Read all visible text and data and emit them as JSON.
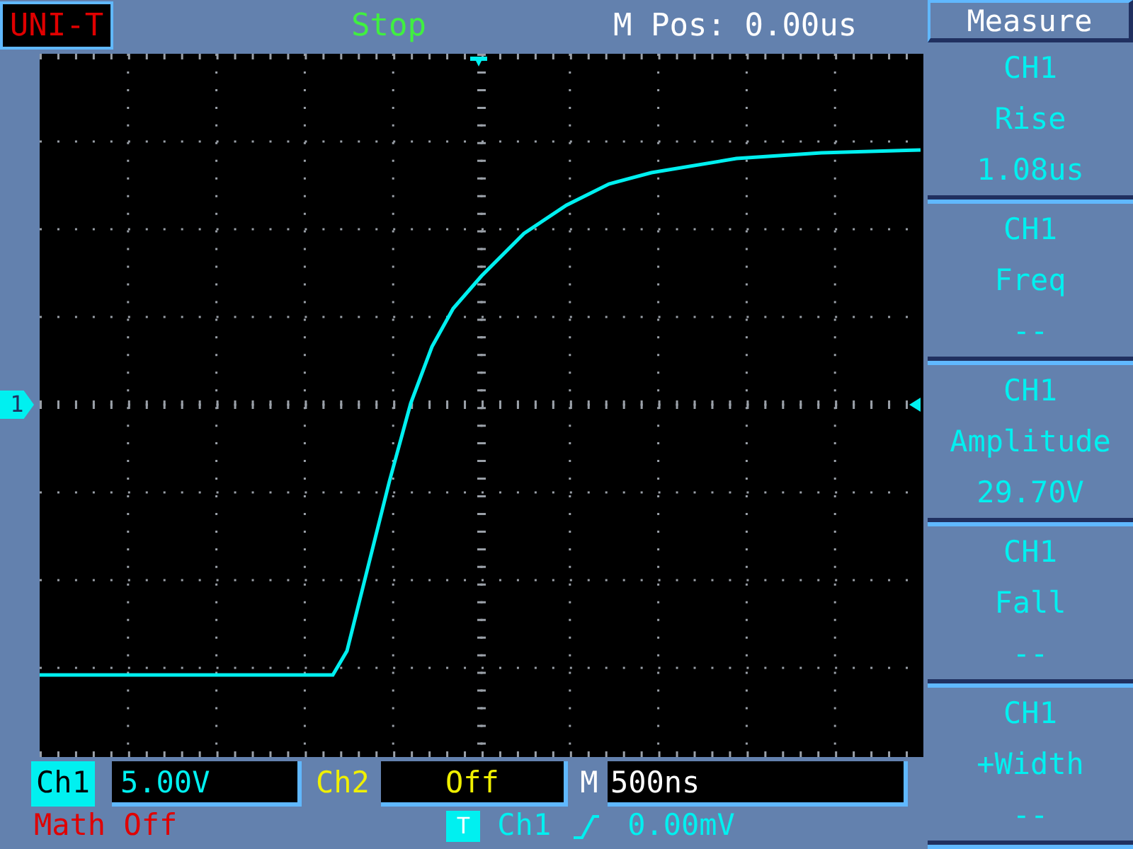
{
  "brand": "UNI-T",
  "run_state": "Stop",
  "horizontal_position": "M Pos: 0.00us",
  "channel_marker": "1",
  "menu": {
    "title": "Measure",
    "items": [
      {
        "channel": "CH1",
        "name": "Rise",
        "value": "1.08us"
      },
      {
        "channel": "CH1",
        "name": "Freq",
        "value": "--"
      },
      {
        "channel": "CH1",
        "name": "Amplitude",
        "value": "29.70V"
      },
      {
        "channel": "CH1",
        "name": "Fall",
        "value": "--"
      },
      {
        "channel": "CH1",
        "name": "+Width",
        "value": "--"
      }
    ]
  },
  "bottom": {
    "ch1": {
      "label": "Ch1",
      "scale": "5.00V"
    },
    "ch2": {
      "label": "Ch2",
      "scale": "Off"
    },
    "timebase": {
      "label": "M",
      "value": "500ns"
    },
    "math": "Math Off",
    "trigger": {
      "badge": "T",
      "source": "Ch1",
      "level": "0.00mV"
    }
  }
}
